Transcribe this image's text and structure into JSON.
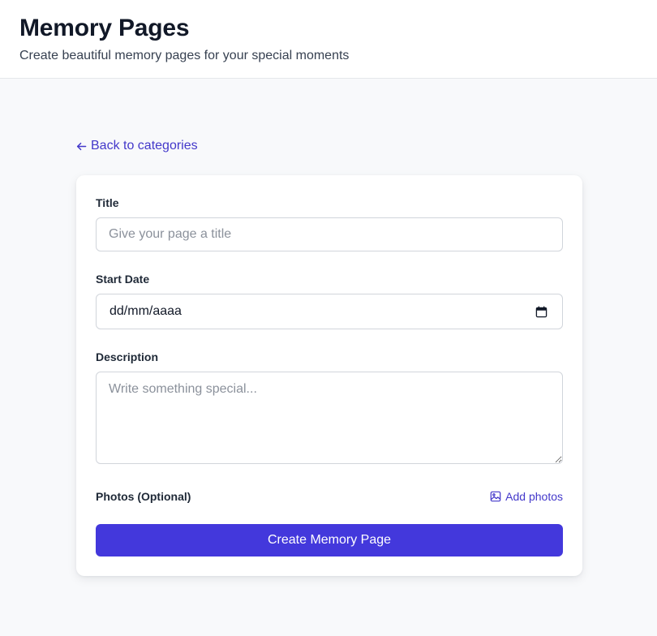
{
  "header": {
    "title": "Memory Pages",
    "subtitle": "Create beautiful memory pages for your special moments"
  },
  "nav": {
    "back_label": "Back to categories",
    "back_icon": "arrow-left-icon"
  },
  "form": {
    "title_label": "Title",
    "title_placeholder": "Give your page a title",
    "title_value": "",
    "start_date_label": "Start Date",
    "start_date_value": "dd/mm/aaaa",
    "calendar_icon": "calendar-icon",
    "description_label": "Description",
    "description_placeholder": "Write something special...",
    "description_value": "",
    "photos_label": "Photos (Optional)",
    "add_photos_label": "Add photos",
    "add_photos_icon": "image-icon",
    "submit_label": "Create Memory Page"
  },
  "colors": {
    "accent": "#4338dc",
    "link": "#4338ca",
    "page_background": "#f8f9fb",
    "card_background": "#ffffff",
    "input_border": "#d1d5db"
  }
}
